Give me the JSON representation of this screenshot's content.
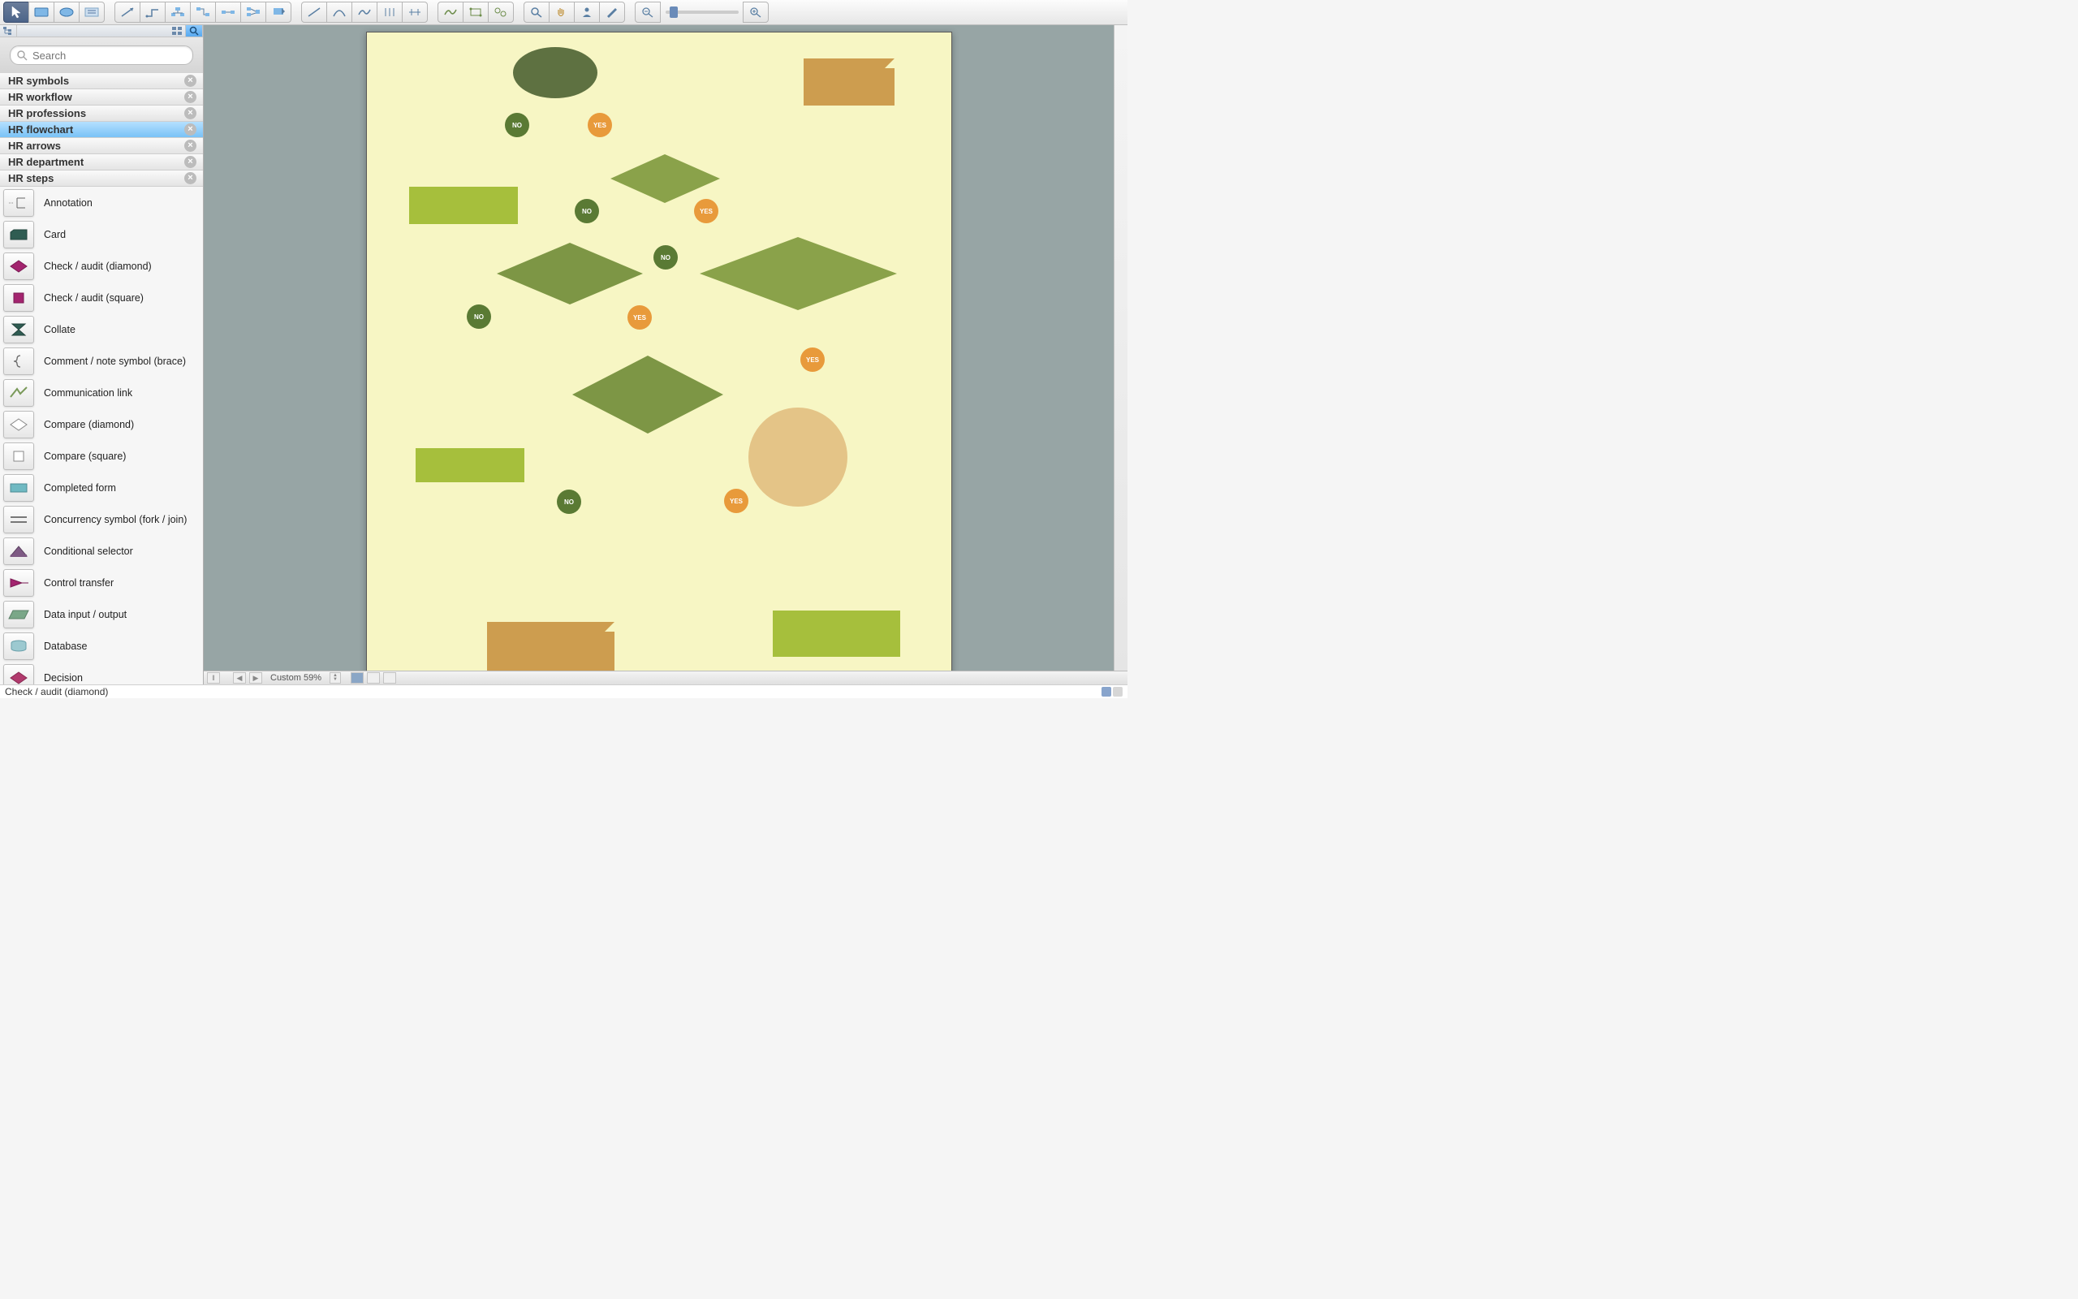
{
  "search": {
    "placeholder": "Search"
  },
  "libs": [
    {
      "label": "HR symbols",
      "selected": false
    },
    {
      "label": "HR workflow",
      "selected": false
    },
    {
      "label": "HR professions",
      "selected": false
    },
    {
      "label": "HR flowchart",
      "selected": true
    },
    {
      "label": "HR arrows",
      "selected": false
    },
    {
      "label": "HR department",
      "selected": false
    },
    {
      "label": "HR steps",
      "selected": false
    }
  ],
  "shapes": [
    {
      "label": "Annotation"
    },
    {
      "label": "Card"
    },
    {
      "label": "Check / audit (diamond)"
    },
    {
      "label": "Check / audit (square)"
    },
    {
      "label": "Collate"
    },
    {
      "label": "Comment / note symbol (brace)"
    },
    {
      "label": "Communication link"
    },
    {
      "label": "Compare (diamond)"
    },
    {
      "label": "Compare (square)"
    },
    {
      "label": "Completed form"
    },
    {
      "label": "Concurrency symbol (fork / join)"
    },
    {
      "label": "Conditional selector"
    },
    {
      "label": "Control transfer"
    },
    {
      "label": "Data input / output"
    },
    {
      "label": "Database"
    },
    {
      "label": "Decision"
    }
  ],
  "canvas_labels": {
    "no": "NO",
    "yes": "YES"
  },
  "bottom": {
    "zoom": "Custom 59%"
  },
  "status": {
    "text": "Check / audit (diamond)"
  }
}
